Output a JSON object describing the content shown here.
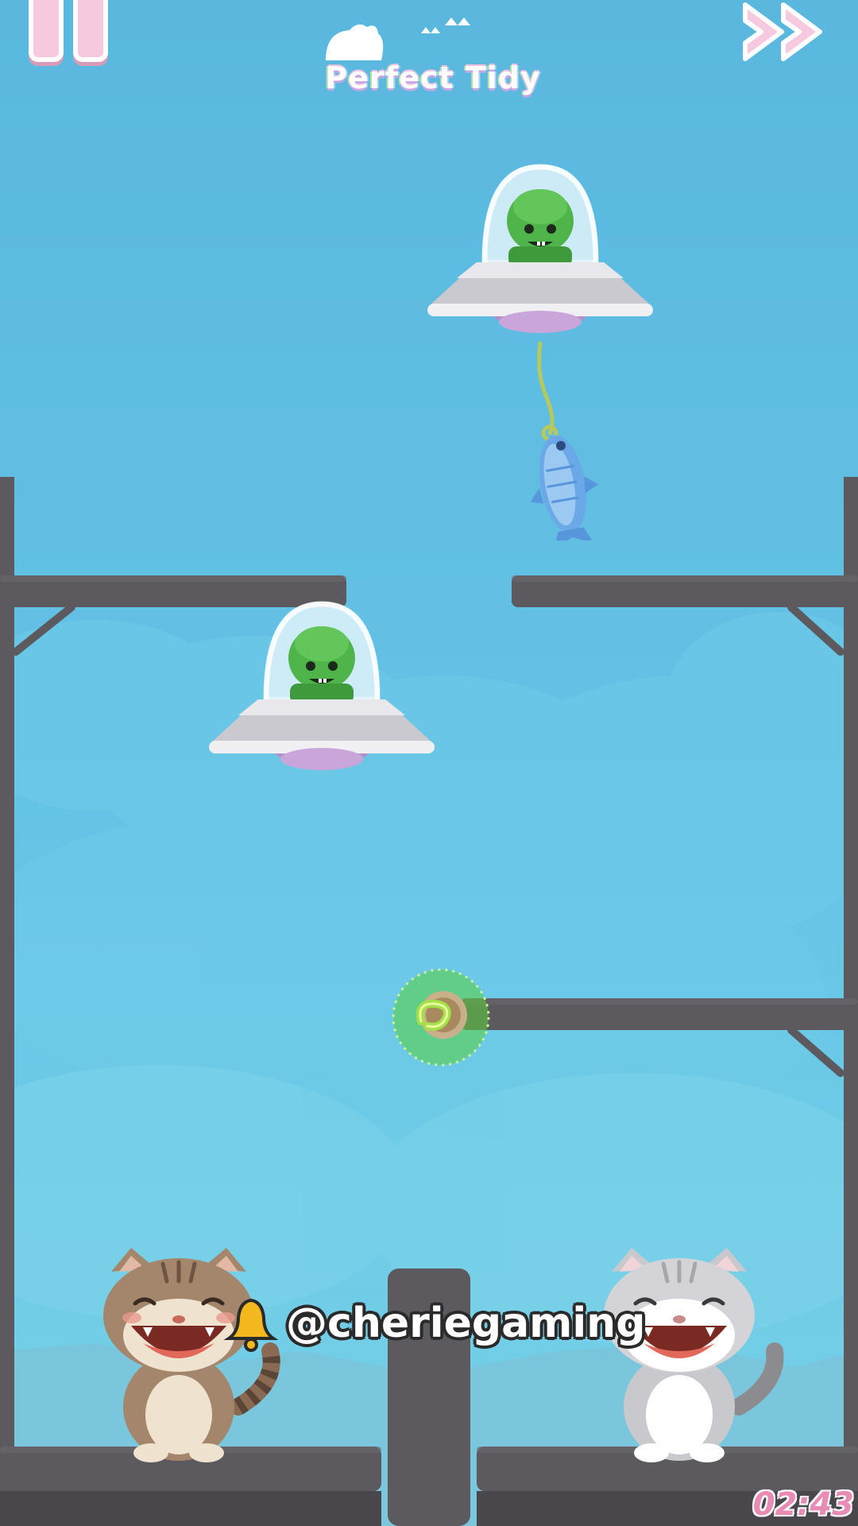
{
  "game": {
    "brand_text": "Perfect Tidy",
    "timer": "02:43",
    "watermark": "@cheriegaming"
  },
  "hud": {
    "pause_icon": "pause-icon",
    "skip_icon": "fast-forward-icon",
    "bell_icon": "bell-icon",
    "pin_icon": "link-pin-icon"
  },
  "colors": {
    "sky": "#5ab8df",
    "beam": "#5e5a5e",
    "ui_pink": "#f7c9df",
    "alien_green": "#4fb54a",
    "pin_green": "#8edb3f"
  }
}
